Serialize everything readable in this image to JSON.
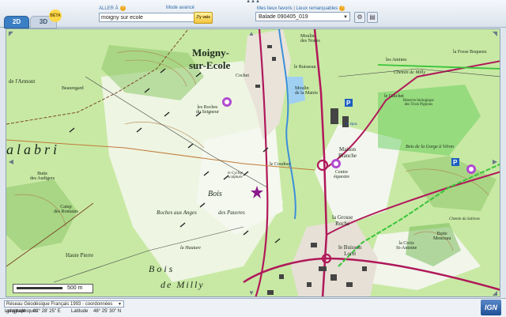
{
  "header": {
    "allera_label": "ALLER À",
    "mode_label": "Mode avancé",
    "search_value": "moigny sur ecole",
    "go_label": "J'y vais",
    "favorites_link": "Mes lieux favoris",
    "remarkable_link": "Lieux remarquables",
    "favorite_selected": "Balade 090405_019",
    "beta_label": "BÉTA"
  },
  "tabs": {
    "tab_2d": "2D",
    "tab_3d": "3D"
  },
  "map": {
    "labels": {
      "moigny1": "Moigny-",
      "moigny2": "sur-Ecole",
      "armont": "de l'Armont",
      "beauregard": "Beauregard",
      "calabri": "alabri",
      "butte_audigers": "Butte\ndes Audigers",
      "romains": "Camp\ndes Romains",
      "haute_pierre": "Haute Pierre",
      "roches_seigneur": "les Roches\ndu Seigneur",
      "coudray": "le Coudray",
      "cyclop": "le Cyclop\nsculpture",
      "bois": "Bois",
      "roches_anges": "Roches aux Anges",
      "pauvres": "des Pauvres",
      "hauture": "la Hauture",
      "bois_milly": "Bois",
      "milly": "de Milly",
      "moulin_noues": "Moulin\ndes Noues",
      "ruisseau": "le Ruisseau",
      "moulin_mairie": "Moulin\nde la Mairie",
      "maison_blanche": "Maison\nBlanche",
      "centre_equestre": "Centre\néquestre",
      "grosse_roche": "la Grosse\nRoche",
      "buisson_loret": "le Buisson\nLoret",
      "amines": "les Amines",
      "fosse_boqueux": "la Fosse Boqueux",
      "guichet": "le Guichet",
      "reserve": "Réserve biologique\ndes Trois Pignons",
      "chemin_milly": "Chemin de Milly",
      "bois_gorge": "Bois de la Gorge à Véron",
      "butte_monceau": "Butte\nMonceau",
      "croix_antoine": "la Croix\nSt-Antoine",
      "sablons": "Chemin du Sablons",
      "cochet": "Cochet",
      "st_epur": "St. épur."
    },
    "scale_label": "500 m"
  },
  "footer": {
    "crs_selected": "Réseau Géodésique Français 1993 - coordonnées géographiques",
    "longitude_label": "Longitude",
    "longitude_value": "02° 28' 25\" E",
    "latitude_label": "Latitude",
    "latitude_value": "48° 25' 30\" N",
    "logo": "IGN"
  },
  "icons": [
    "help-icon",
    "settings-icon",
    "print-icon",
    "chevron-down-icon",
    "compass-arrow-icon",
    "parking-icon",
    "monument-icon"
  ],
  "colors": {
    "accent": "#3a7fc4",
    "forest": "#c8e9a4",
    "road": "#b0185a"
  }
}
